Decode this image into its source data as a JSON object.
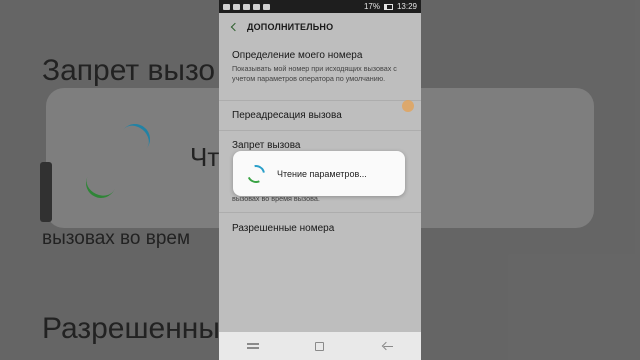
{
  "status_bar": {
    "battery_percent": "17%",
    "time": "13:29"
  },
  "header": {
    "title": "ДОПОЛНИТЕЛЬНО"
  },
  "settings": [
    {
      "title": "Определение моего номера",
      "subtitle": "Показывать мой номер при исходящих вызовах с учетом параметров оператора по умолчанию."
    },
    {
      "title": "Переадресация вызова"
    },
    {
      "title": "Запрет вызова",
      "subtitle": "вызовах во время вызова."
    },
    {
      "title": "Разрешенные номера"
    }
  ],
  "dialog": {
    "message": "Чтение параметров..."
  },
  "background_blur": {
    "line1": "Запрет вызо",
    "line2": "Чт             ов...",
    "line3": "вызовах во врем",
    "line4": "Разрешенны"
  },
  "colors": {
    "accent_green": "#3b7a3b",
    "spinner_blue": "#2a9fc9",
    "spinner_green": "#3aa344"
  }
}
